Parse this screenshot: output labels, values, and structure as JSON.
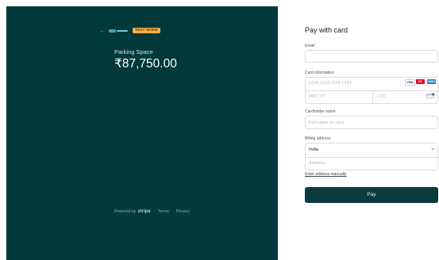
{
  "left": {
    "back_arrow": "←",
    "badge": "TEST MODE",
    "product_name": "Parking Space",
    "amount": "₹87,750.00",
    "powered_by": "Powered by",
    "stripe": "stripe",
    "terms": "Terms",
    "privacy": "Privacy"
  },
  "form": {
    "title": "Pay with card",
    "email_label": "Email",
    "card_label": "Card information",
    "card_number_placeholder": "1234 1234 1234 1234",
    "expiry_placeholder": "MM / YY",
    "cvc_placeholder": "CVC",
    "card_brands": [
      "VISA",
      "MC",
      "AMEX"
    ],
    "cardholder_label": "Cardholder name",
    "cardholder_placeholder": "Full name on card",
    "billing_label": "Billing address",
    "country": "India",
    "address_placeholder": "Address",
    "manual_link": "Enter address manually",
    "pay_button": "Pay"
  },
  "colors": {
    "panel": "#02393a",
    "badge": "#fdb34d",
    "pay": "#0b3b3c"
  }
}
